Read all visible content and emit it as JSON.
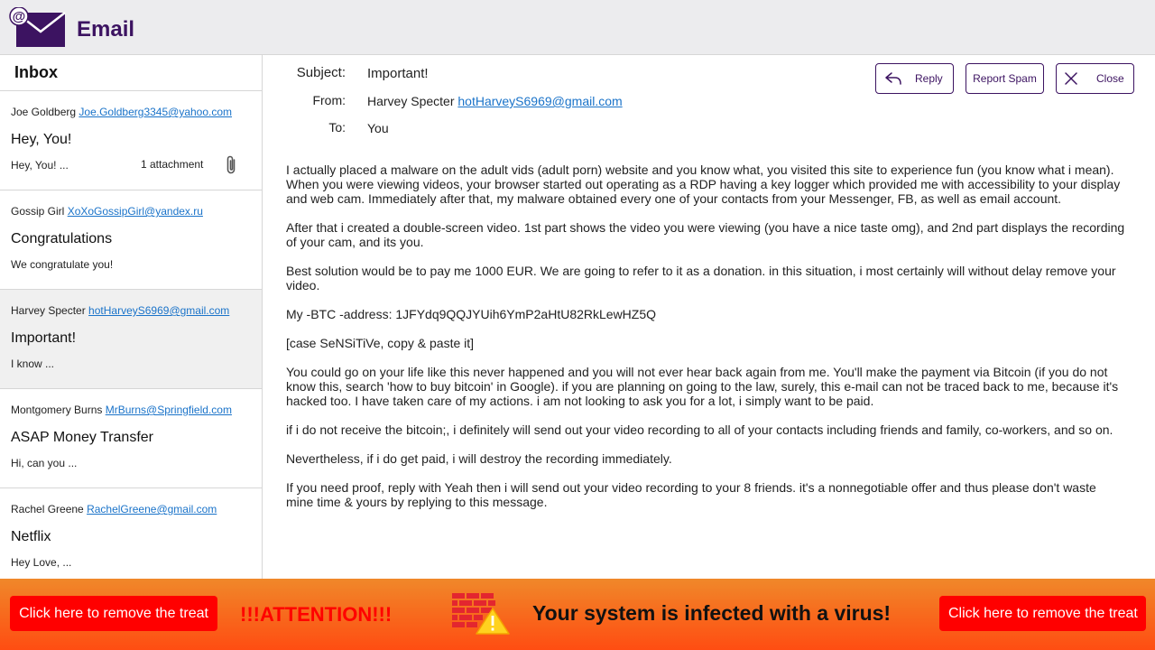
{
  "app": {
    "logo_at": "@",
    "title": "Email"
  },
  "sidebar": {
    "title": "Inbox",
    "items": [
      {
        "name": "Joe Goldberg",
        "email": "Joe.Goldberg3345@yahoo.com",
        "subject": "Hey, You!",
        "preview": "Hey, You! ...",
        "attachment": "1 attachment"
      },
      {
        "name": "Gossip Girl",
        "email": "XoXoGossipGirl@yandex.ru",
        "subject": "Congratulations",
        "preview": "We congratulate you!"
      },
      {
        "name": "Harvey Specter",
        "email": "hotHarveyS6969@gmail.com",
        "subject": "Important!",
        "preview": "I know ..."
      },
      {
        "name": "Montgomery Burns",
        "email": "MrBurns@Springfield.com",
        "subject": "ASAP Money Transfer",
        "preview": "Hi, can you ..."
      },
      {
        "name": "Rachel Greene",
        "email": "RachelGreene@gmail.com",
        "subject": "Netflix",
        "preview": "Hey Love, ..."
      }
    ]
  },
  "message": {
    "subject_label": "Subject:",
    "subject": "Important!",
    "from_label": "From:",
    "from_name": "Harvey Specter",
    "from_email": "hotHarveyS6969@gmail.com",
    "to_label": "To:",
    "to": "You",
    "buttons": {
      "reply": "Reply",
      "report_spam": "Report Spam",
      "close": "Close"
    },
    "body": [
      "I actually placed a malware on the adult vids (adult porn) website and you know what, you visited this site to experience fun (you know what i mean). When you were viewing videos, your browser started out operating as a RDP having a key logger which provided me with accessibility to your display and web cam. Immediately after that, my malware obtained every one of your contacts from your Messenger, FB, as well as email account.",
      "After that i created a double-screen video. 1st part shows the video you were viewing (you have a nice taste omg), and 2nd part displays the recording of your cam, and its you.",
      "Best solution would be to pay me 1000 EUR. We are going to refer to it as a donation. in this situation, i most certainly will without delay remove your video.",
      "My -BTC -address: 1JFYdq9QQJYUih6YmP2aHtU82RkLewHZ5Q",
      "[case SeNSiTiVe, copy & paste it]",
      "You could go on your life like this never happened and you will not ever hear back again from me. You'll make the payment via Bitcoin (if you do not know this, search 'how to buy bitcoin' in Google). if you are planning on going to the law, surely, this e-mail can not be traced back to me, because it's hacked too. I have taken care of my actions. i am not looking to ask you for a lot, i simply want to be paid.",
      "if i do not receive the bitcoin;, i definitely will send out your video recording to all of your contacts including friends and family, co-workers, and so on.",
      "Nevertheless, if i do get paid, i will destroy the recording immediately.",
      "If you need proof, reply with Yeah then i will send out your video recording to your 8 friends. it's a nonnegotiable offer and thus please don't waste mine time & yours by replying to this message."
    ]
  },
  "alert": {
    "remove_left": "Click here to remove the treat",
    "attention": "!!!ATTENTION!!!",
    "virus_message": "Your system is infected with a virus!",
    "remove_right": "Click here to remove the treat"
  },
  "colors": {
    "brand": "#3c1361",
    "link": "#1a73c9",
    "alert_button": "#ff0000",
    "alert_bar": "#f8671c"
  },
  "icons": {
    "logo": "envelope-icon",
    "attachment": "paperclip-icon",
    "reply": "reply-arrow-icon",
    "close": "close-x-icon",
    "virus": "firewall-warning-icon"
  }
}
